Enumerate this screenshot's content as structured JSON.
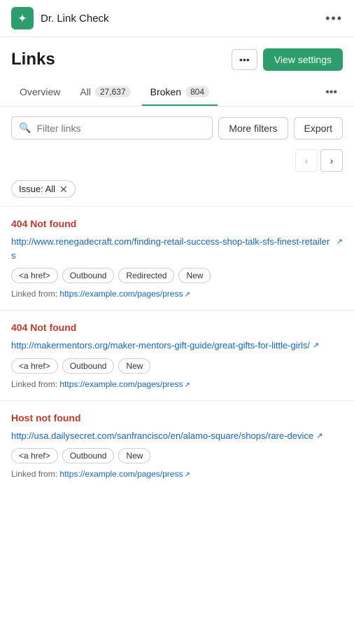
{
  "topbar": {
    "logo_letter": "✦",
    "app_title": "Dr. Link Check",
    "more_dots": "•••"
  },
  "page": {
    "title": "Links",
    "more_label": "•••",
    "view_settings_label": "View settings"
  },
  "tabs": [
    {
      "id": "overview",
      "label": "Overview",
      "badge": null,
      "active": false
    },
    {
      "id": "all",
      "label": "All",
      "badge": "27,637",
      "active": false
    },
    {
      "id": "broken",
      "label": "Broken",
      "badge": "804",
      "active": true
    }
  ],
  "tabs_more": "•••",
  "filter": {
    "search_placeholder": "Filter links",
    "more_filters_label": "More filters",
    "export_label": "Export"
  },
  "filter_tags": [
    {
      "label": "Issue: All",
      "removable": true
    }
  ],
  "link_items": [
    {
      "error": "404 Not found",
      "url": "http://www.renegadecraft.com/finding-retail-success-shop-talk-sfs-finest-retailers",
      "tags": [
        "<a href>",
        "Outbound",
        "Redirected",
        "New"
      ],
      "linked_from_label": "Linked from:",
      "linked_from_url": "https://example.com/pages/press"
    },
    {
      "error": "404 Not found",
      "url": "http://makermentors.org/maker-mentors-gift-guide/great-gifts-for-little-girls/",
      "tags": [
        "<a href>",
        "Outbound",
        "New"
      ],
      "linked_from_label": "Linked from:",
      "linked_from_url": "https://example.com/pages/press"
    },
    {
      "error": "Host not found",
      "url": "http://usa.dailysecret.com/sanfrancisco/en/alamo-square/shops/rare-device",
      "tags": [
        "<a href>",
        "Outbound",
        "New"
      ],
      "linked_from_label": "Linked from:",
      "linked_from_url": "https://example.com/pages/press"
    }
  ]
}
